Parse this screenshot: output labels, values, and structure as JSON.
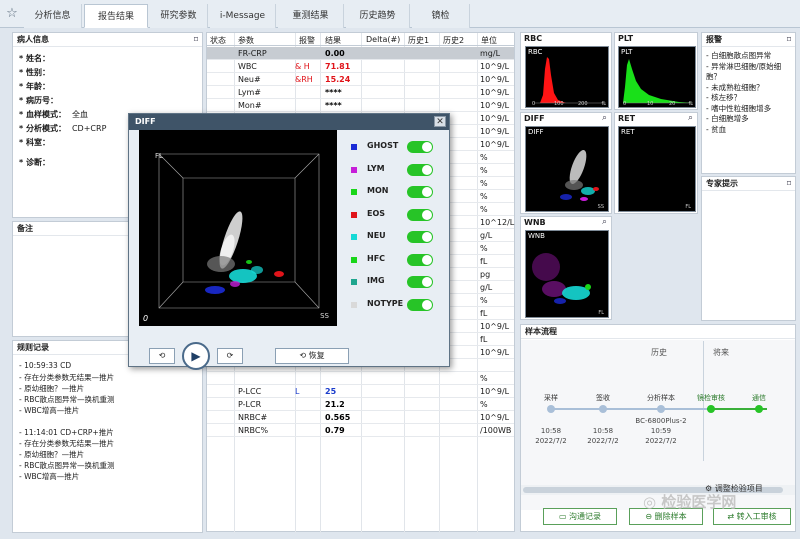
{
  "tabs": [
    "分析信息",
    "报告结果",
    "研究参数",
    "i-Message",
    "重测结果",
    "历史趋势",
    "镜检"
  ],
  "active_tab": 1,
  "patient": {
    "title": "病人信息",
    "fields": [
      {
        "label": "* 姓名：",
        "value": ""
      },
      {
        "label": "* 性别：",
        "value": ""
      },
      {
        "label": "* 年龄：",
        "value": ""
      },
      {
        "label": "* 病历号：",
        "value": ""
      },
      {
        "label": "* 血样模式：",
        "value": "全血"
      },
      {
        "label": "* 分析模式：",
        "value": "CD+CRP"
      },
      {
        "label": "* 科室：",
        "value": ""
      },
      {
        "label": "* 诊断：",
        "value": ""
      }
    ]
  },
  "notes": {
    "title": "备注"
  },
  "rule_log": {
    "title": "规则记录",
    "lines": [
      "- 10:59:33 CD",
      "- 存在分类参数无结果—推片",
      "- 原幼细胞？—推片",
      "- RBC散点图异常—换机重测",
      "- WBC增高—推片",
      "",
      "- 11:14:01 CD+CRP+推片",
      "- 存在分类参数无结果—推片",
      "- 原幼细胞？—推片",
      "- RBC散点图异常—换机重测",
      "- WBC增高—推片"
    ]
  },
  "results": {
    "headers": [
      "状态",
      "参数",
      "报警",
      "结果",
      "Delta(#)",
      "历史1",
      "历史2",
      "单位"
    ],
    "rows": [
      {
        "param": "FR-CRP",
        "flag": "",
        "result": "0.00",
        "unit": "mg/L",
        "highlight": true,
        "result_color": "#000"
      },
      {
        "param": "WBC",
        "flag": "& H",
        "result": "71.81",
        "unit": "10^9/L",
        "result_color": "#e0141a"
      },
      {
        "param": "Neu#",
        "flag": "&RH",
        "result": "15.24",
        "unit": "10^9/L",
        "result_color": "#e0141a"
      },
      {
        "param": "Lym#",
        "flag": "",
        "result": "****",
        "unit": "10^9/L",
        "result_color": "#000"
      },
      {
        "param": "Mon#",
        "flag": "",
        "result": "****",
        "unit": "10^9/L",
        "result_color": "#000"
      },
      {
        "param": "",
        "flag": "",
        "result": "",
        "unit": "10^9/L",
        "result_color": "#000"
      },
      {
        "param": "",
        "flag": "",
        "result": "",
        "unit": "10^9/L",
        "result_color": "#000"
      },
      {
        "param": "",
        "flag": "",
        "result": "",
        "unit": "10^9/L",
        "result_color": "#000"
      },
      {
        "param": "",
        "flag": "",
        "result": "",
        "unit": "%",
        "result_color": "#000"
      },
      {
        "param": "",
        "flag": "",
        "result": "",
        "unit": "%",
        "result_color": "#000"
      },
      {
        "param": "",
        "flag": "",
        "result": "",
        "unit": "%",
        "result_color": "#000"
      },
      {
        "param": "",
        "flag": "",
        "result": "",
        "unit": "%",
        "result_color": "#000"
      },
      {
        "param": "",
        "flag": "",
        "result": "",
        "unit": "%",
        "result_color": "#000"
      },
      {
        "param": "",
        "flag": "",
        "result": "",
        "unit": "10^12/L",
        "result_color": "#000"
      },
      {
        "param": "",
        "flag": "",
        "result": "",
        "unit": "g/L",
        "result_color": "#000"
      },
      {
        "param": "",
        "flag": "",
        "result": "",
        "unit": "%",
        "result_color": "#000"
      },
      {
        "param": "",
        "flag": "",
        "result": "",
        "unit": "fL",
        "result_color": "#000"
      },
      {
        "param": "",
        "flag": "",
        "result": "",
        "unit": "pg",
        "result_color": "#000"
      },
      {
        "param": "",
        "flag": "",
        "result": "",
        "unit": "g/L",
        "result_color": "#000"
      },
      {
        "param": "",
        "flag": "",
        "result": "",
        "unit": "%",
        "result_color": "#000"
      },
      {
        "param": "",
        "flag": "",
        "result": "",
        "unit": "fL",
        "result_color": "#000"
      },
      {
        "param": "",
        "flag": "",
        "result": "",
        "unit": "10^9/L",
        "result_color": "#000"
      },
      {
        "param": "",
        "flag": "",
        "result": "",
        "unit": "fL",
        "result_color": "#000"
      },
      {
        "param": "",
        "flag": "",
        "result": "",
        "unit": "10^9/L",
        "result_color": "#000"
      },
      {
        "param": "",
        "flag": "",
        "result": "",
        "unit": "",
        "result_color": "#000"
      },
      {
        "param": "",
        "flag": "",
        "result": "",
        "unit": "%",
        "result_color": "#000"
      },
      {
        "param": "P-LCC",
        "flag": "L",
        "result": "25",
        "unit": "10^9/L",
        "result_color": "#1a3ccc",
        "flag_color": "#1a3ccc"
      },
      {
        "param": "P-LCR",
        "flag": "",
        "result": "21.2",
        "unit": "%",
        "result_color": "#000"
      },
      {
        "param": "NRBC#",
        "flag": "",
        "result": "0.565",
        "unit": "10^9/L",
        "result_color": "#000"
      },
      {
        "param": "NRBC%",
        "flag": "",
        "result": "0.79",
        "unit": "/100WB",
        "result_color": "#000"
      }
    ]
  },
  "graphs": {
    "rbc": {
      "title": "RBC",
      "inner": "RBC",
      "ticks": [
        "0",
        "100",
        "200",
        "fL"
      ]
    },
    "plt": {
      "title": "PLT",
      "inner": "PLT",
      "ticks": [
        "0",
        "10",
        "20",
        "fL"
      ]
    },
    "diff": {
      "title": "DIFF",
      "inner": "DIFF",
      "axis": "SS"
    },
    "ret": {
      "title": "RET",
      "inner": "RET",
      "axis": "FL"
    },
    "wnb": {
      "title": "WNB",
      "inner": "WNB",
      "axis": "FL"
    }
  },
  "alarm": {
    "title": "报警",
    "lines": [
      "- 白细胞散点图异常",
      "- 异常淋巴细胞/原始细",
      "胞？",
      "- 未成熟粒细胞？",
      "- 核左移？",
      "- 嗜中性粒细胞增多",
      "- 白细胞增多",
      "- 贫血"
    ]
  },
  "expert": {
    "title": "专家提示"
  },
  "flow": {
    "title": "样本流程",
    "history_label": "历史",
    "future_label": "将来",
    "steps": [
      {
        "name": "采样",
        "sub": "",
        "time": "10:58",
        "date": "2022/7/2"
      },
      {
        "name": "签收",
        "sub": "",
        "time": "10:58",
        "date": "2022/7/2"
      },
      {
        "name": "分析样本",
        "sub": "BC-6800Plus-2",
        "time": "10:59",
        "date": "2022/7/2"
      },
      {
        "name": "镜检审核",
        "sub": "",
        "time": "",
        "date": ""
      },
      {
        "name": "通信",
        "sub": "",
        "time": "",
        "date": ""
      }
    ],
    "adjust_label": "调整检验项目"
  },
  "bottom_buttons": [
    "沟通记录",
    "删除样本",
    "转入工审核"
  ],
  "watermark": "检验医学网",
  "dialog": {
    "title": "DIFF",
    "legend": [
      {
        "name": "GHOST",
        "color": "#1b2bd6"
      },
      {
        "name": "LYM",
        "color": "#c61ed9"
      },
      {
        "name": "MON",
        "color": "#19d619"
      },
      {
        "name": "EOS",
        "color": "#e0141a"
      },
      {
        "name": "NEU",
        "color": "#16d9d6"
      },
      {
        "name": "HFC",
        "color": "#19d619"
      },
      {
        "name": "IMG",
        "color": "#1fa68f"
      },
      {
        "name": "NOTYPE",
        "color": "#d9d9d9"
      }
    ],
    "axis_labels": {
      "origin": "0",
      "x": "SS",
      "y": "FL"
    },
    "restore_label": "恢复"
  },
  "colors": {
    "accent": "#27c427",
    "header_bg": "#3f5468",
    "highlight_row": "#c7ccd2"
  }
}
